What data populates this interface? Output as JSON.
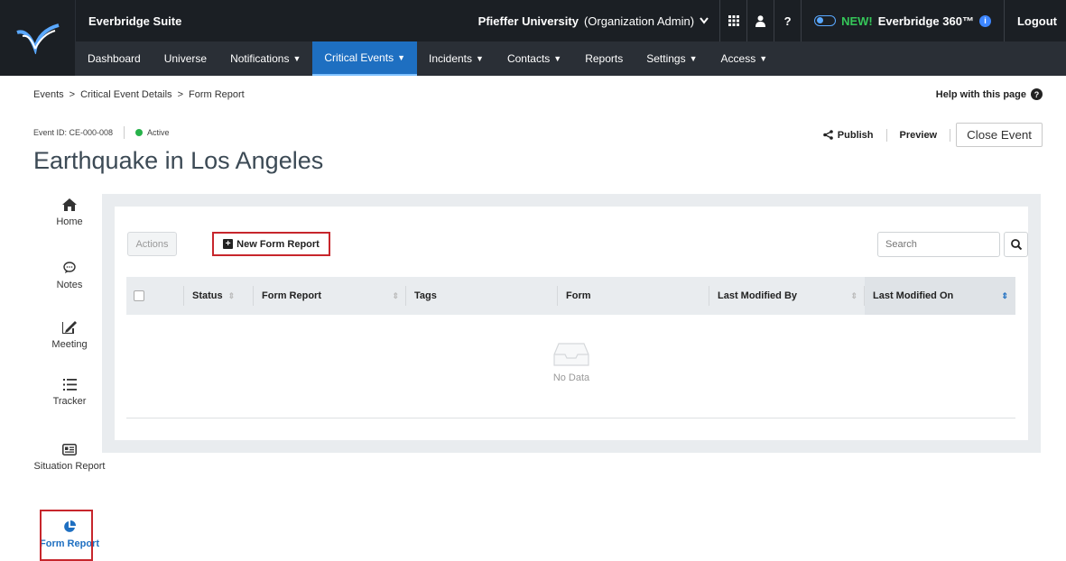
{
  "app": {
    "suite_title": "Everbridge Suite",
    "org_name": "Pfieffer University",
    "org_role": "(Organization Admin)",
    "new_label": "NEW!",
    "product_label": "Everbridge 360™",
    "logout": "Logout",
    "icons": [
      "apps-grid-icon",
      "user-icon",
      "help-icon",
      "toggle-icon",
      "info-icon"
    ]
  },
  "nav": {
    "items": [
      {
        "label": "Dashboard",
        "dropdown": false
      },
      {
        "label": "Universe",
        "dropdown": false
      },
      {
        "label": "Notifications",
        "dropdown": true
      },
      {
        "label": "Critical Events",
        "dropdown": true,
        "active": true
      },
      {
        "label": "Incidents",
        "dropdown": true
      },
      {
        "label": "Contacts",
        "dropdown": true
      },
      {
        "label": "Reports",
        "dropdown": false
      },
      {
        "label": "Settings",
        "dropdown": true
      },
      {
        "label": "Access",
        "dropdown": true
      }
    ]
  },
  "breadcrumb": {
    "items": [
      "Events",
      "Critical Event Details",
      "Form Report"
    ],
    "separator": ">"
  },
  "help": "Help with this page",
  "event": {
    "id_label": "Event ID: CE-000-008",
    "status": "Active",
    "title": "Earthquake in Los Angeles"
  },
  "event_actions": {
    "publish": "Publish",
    "preview": "Preview",
    "close": "Close Event"
  },
  "sidebar": {
    "items": [
      {
        "label": "Home",
        "icon": "home-icon"
      },
      {
        "label": "Notes",
        "icon": "chat-bubble-icon"
      },
      {
        "label": "Meeting",
        "icon": "meeting-icon"
      },
      {
        "label": "Tracker",
        "icon": "list-icon"
      },
      {
        "label": "Situation Report",
        "icon": "report-card-icon"
      },
      {
        "label": "Form Report",
        "icon": "pie-chart-icon",
        "active": true
      }
    ]
  },
  "toolbar": {
    "actions": "Actions",
    "new_form_report": "New Form Report",
    "search_placeholder": "Search"
  },
  "table": {
    "columns": [
      "Status",
      "Form Report",
      "Tags",
      "Form",
      "Last Modified By",
      "Last Modified On"
    ],
    "sorted_column": "Last Modified On",
    "empty_text": "No Data"
  },
  "colors": {
    "topbar": "#1b1f24",
    "nav_active": "#1e6fc1",
    "highlight": "#c7262c",
    "status_active": "#27b24a"
  }
}
